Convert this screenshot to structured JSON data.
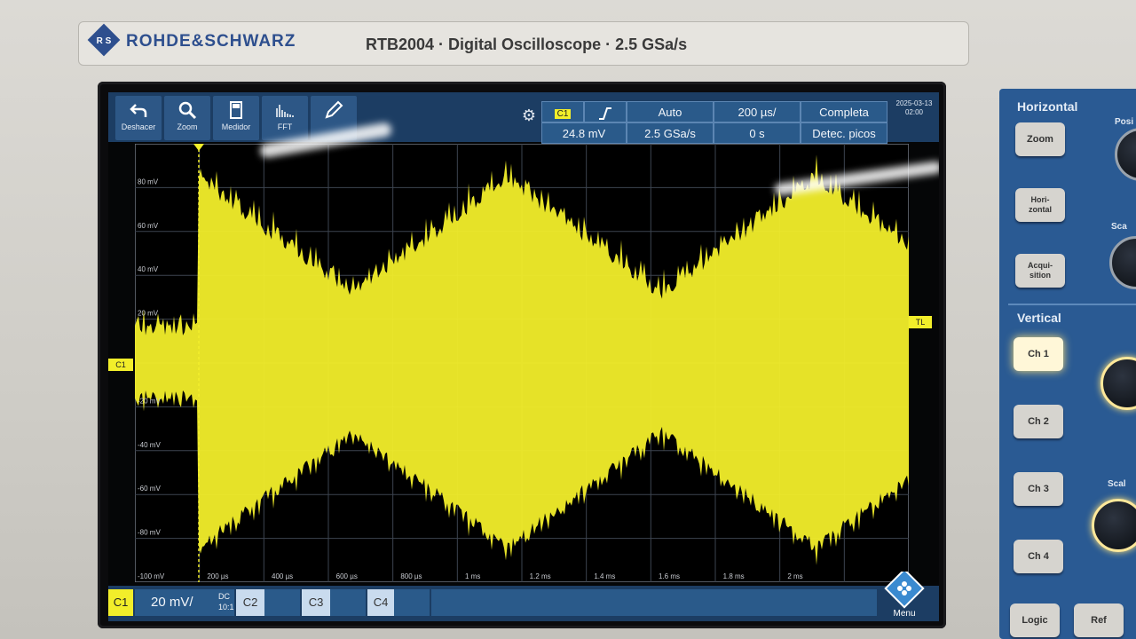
{
  "brand": "ROHDE&SCHWARZ",
  "model_line": "RTB2004 · Digital Oscilloscope · 2.5 GSa/s",
  "toolbar": {
    "buttons": [
      {
        "label": "Deshacer",
        "icon": "undo-icon"
      },
      {
        "label": "Zoom",
        "icon": "zoom-icon"
      },
      {
        "label": "Medidor",
        "icon": "meter-icon"
      },
      {
        "label": "FFT",
        "icon": "fft-icon"
      },
      {
        "label": "",
        "icon": "pen-icon"
      }
    ],
    "channel_badge": "C1",
    "trigger_level": "24.8 mV",
    "trigger_mode": "Auto",
    "sample_rate": "2.5 GSa/s",
    "time_scale": "200 µs/",
    "time_offset": "0 s",
    "acq_mode": "Completa",
    "acq_detect": "Detec. picos",
    "date": "2025-03-13",
    "time": "02:00"
  },
  "grid": {
    "y_labels": [
      "80 mV",
      "60 mV",
      "40 mV",
      "20 mV",
      "-20 mV",
      "-40 mV",
      "-60 mV",
      "-80 mV",
      "-100 mV"
    ],
    "x_labels": [
      "200 µs",
      "400 µs",
      "600 µs",
      "800 µs",
      "1 ms",
      "1.2 ms",
      "1.4 ms",
      "1.6 ms",
      "1.8 ms",
      "2 ms"
    ],
    "ch1_marker": "C1",
    "trigger_marker": "TL"
  },
  "bottom": {
    "ch1": "C1",
    "ch1_scale": "20 mV/",
    "ch1_coupling": "DC",
    "ch1_probe": "10:1",
    "ch2": "C2",
    "ch3": "C3",
    "ch4": "C4",
    "menu": "Menu"
  },
  "panel": {
    "horizontal_title": "Horizontal",
    "vertical_title": "Vertical",
    "zoom": "Zoom",
    "horizontal_btn": "Hori-\nzontal",
    "acquisition_btn": "Acqui-\nsition",
    "ch1": "Ch 1",
    "ch2": "Ch 2",
    "ch3": "Ch 3",
    "ch4": "Ch 4",
    "logic": "Logic",
    "ref": "Ref",
    "pos_fragment": "Posi",
    "scale_fragment_1": "Sca",
    "scale_fragment_2": "Scal"
  },
  "colors": {
    "trace": "#f2ee2a",
    "toolbar": "#1c3d63",
    "button": "#2d5786",
    "panel": "#2a5a93",
    "brand": "#2e4f8e"
  }
}
